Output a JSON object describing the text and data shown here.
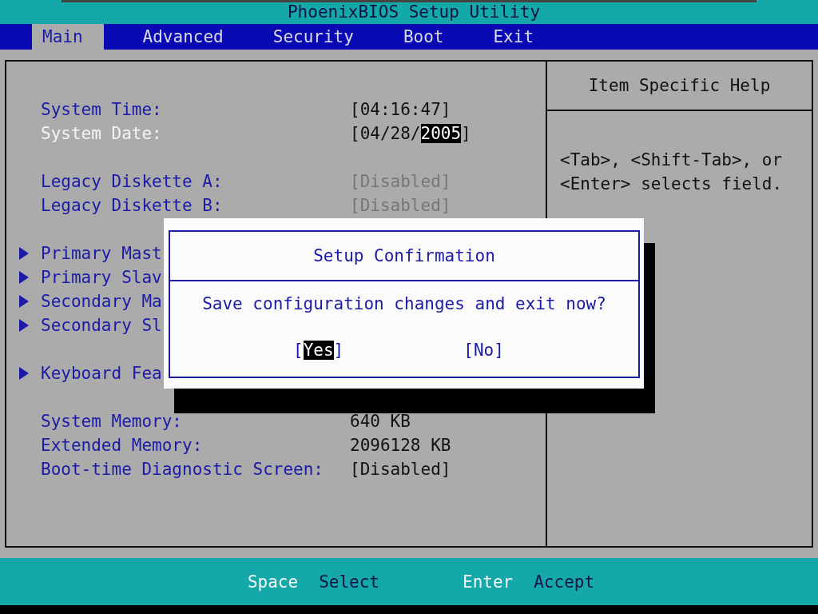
{
  "window": {
    "title": "PhoenixBIOS Setup Utility"
  },
  "tabs": [
    {
      "label": "Main",
      "selected": true
    },
    {
      "label": "Advanced",
      "selected": false
    },
    {
      "label": "Security",
      "selected": false
    },
    {
      "label": "Boot",
      "selected": false
    },
    {
      "label": "Exit",
      "selected": false
    }
  ],
  "settings": {
    "groups": [
      [
        {
          "kind": "setting",
          "label": "System Time:",
          "selected": false,
          "disabled": false,
          "value_parts": [
            {
              "text": "[04:16:47]",
              "highlighted": false
            }
          ]
        },
        {
          "kind": "setting",
          "label": "System Date:",
          "selected": true,
          "disabled": false,
          "value_parts": [
            {
              "text": "[04/28/",
              "highlighted": false
            },
            {
              "text": "2005",
              "highlighted": true
            },
            {
              "text": "]",
              "highlighted": false
            }
          ]
        }
      ],
      [
        {
          "kind": "setting",
          "label": "Legacy Diskette A:",
          "selected": false,
          "disabled": true,
          "value_parts": [
            {
              "text": "[Disabled]",
              "highlighted": false
            }
          ]
        },
        {
          "kind": "setting",
          "label": "Legacy Diskette B:",
          "selected": false,
          "disabled": true,
          "value_parts": [
            {
              "text": "[Disabled]",
              "highlighted": false
            }
          ]
        }
      ],
      [
        {
          "kind": "submenu",
          "label": "Primary Mast",
          "selected": false
        },
        {
          "kind": "submenu",
          "label": "Primary Slav",
          "selected": false
        },
        {
          "kind": "submenu",
          "label": "Secondary Ma",
          "selected": false
        },
        {
          "kind": "submenu",
          "label": "Secondary Sl",
          "selected": false
        }
      ],
      [
        {
          "kind": "submenu",
          "label": "Keyboard Fea",
          "selected": false
        }
      ],
      [
        {
          "kind": "setting",
          "label": "System Memory:",
          "selected": false,
          "disabled": false,
          "value_parts": [
            {
              "text": "640 KB",
              "highlighted": false
            }
          ]
        },
        {
          "kind": "setting",
          "label": "Extended Memory:",
          "selected": false,
          "disabled": false,
          "value_parts": [
            {
              "text": "2096128 KB",
              "highlighted": false
            }
          ]
        },
        {
          "kind": "setting",
          "label": "Boot-time Diagnostic Screen:",
          "selected": false,
          "disabled": false,
          "value_parts": [
            {
              "text": "[Disabled]",
              "highlighted": false
            }
          ]
        }
      ]
    ]
  },
  "help": {
    "title": "Item Specific Help",
    "text": "<Tab>, <Shift-Tab>, or <Enter> selects field."
  },
  "dialog": {
    "title": "Setup Confirmation",
    "message": "Save configuration changes and exit now?",
    "buttons": [
      {
        "open": "[",
        "label": "Yes",
        "close": "]",
        "selected": true
      },
      {
        "open": "[",
        "label": "No",
        "close": "]",
        "selected": false
      }
    ]
  },
  "status_bar": [
    {
      "key": "Space",
      "action": "Select"
    },
    {
      "key": "Enter",
      "action": "Accept"
    }
  ]
}
